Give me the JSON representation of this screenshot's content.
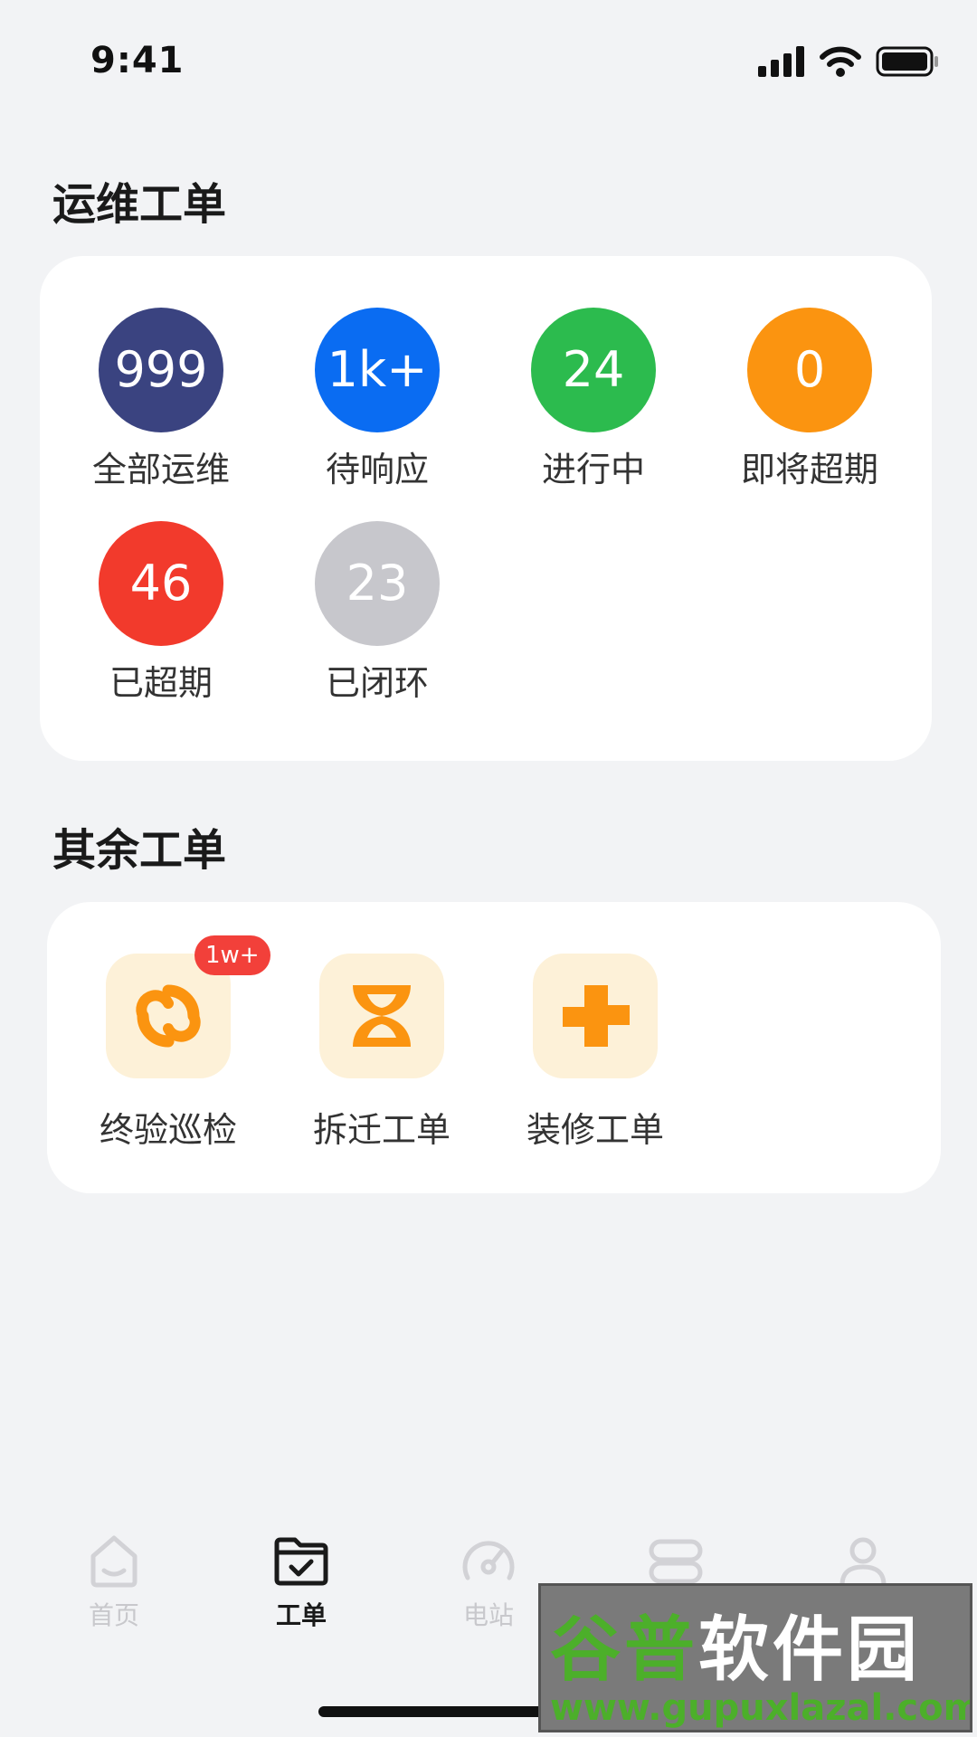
{
  "status_bar": {
    "time": "9:41",
    "icons": [
      "signal-icon",
      "wifi-icon",
      "battery-icon"
    ]
  },
  "ops_section": {
    "title": "运维工单",
    "stats": [
      {
        "value": "999",
        "label": "全部运维",
        "color": "#3a4380"
      },
      {
        "value": "1k+",
        "label": "待响应",
        "color": "#0a6cf2"
      },
      {
        "value": "24",
        "label": "进行中",
        "color": "#2cbb4e"
      },
      {
        "value": "0",
        "label": "即将超期",
        "color": "#fb9410"
      },
      {
        "value": "46",
        "label": "已超期",
        "color": "#f23a2c"
      },
      {
        "value": "23",
        "label": "已闭环",
        "color": "#c7c7cc"
      }
    ]
  },
  "other_section": {
    "title": "其余工单",
    "items": [
      {
        "label": "终验巡检",
        "badge": "1w+",
        "icon": "inspection-icon"
      },
      {
        "label": "拆迁工单",
        "icon": "demolition-icon"
      },
      {
        "label": "装修工单",
        "icon": "renovation-icon"
      }
    ],
    "icon_color": "#fb9410",
    "icon_bg": "#fdf1d8"
  },
  "tabbar": {
    "tabs": [
      {
        "label": "首页",
        "icon": "home-icon",
        "active": false
      },
      {
        "label": "工单",
        "icon": "work-order-icon",
        "active": true
      },
      {
        "label": "电站",
        "icon": "gauge-icon",
        "active": false
      },
      {
        "label": "",
        "icon": "server-icon",
        "active": false
      },
      {
        "label": "",
        "icon": "user-icon",
        "active": false
      }
    ]
  },
  "watermark": {
    "brand_a": "谷普",
    "brand_b": "软件园",
    "url": "www.gupuxlazal.com"
  }
}
